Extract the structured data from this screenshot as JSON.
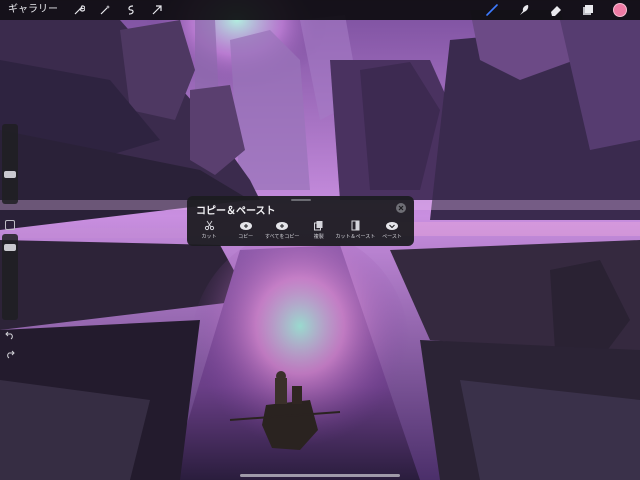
{
  "toolbar": {
    "gallery_label": "ギャラリー",
    "left_icons": [
      "wrench-icon",
      "magic-wand-icon",
      "selection-icon",
      "transform-arrow-icon"
    ],
    "right_icons": [
      "brush-icon",
      "smudge-icon",
      "eraser-icon",
      "layers-icon"
    ],
    "active_color": "#ef7ba5",
    "brush_accent": "#3d7bff"
  },
  "sidebar": {
    "size_level": 0.35,
    "opacity_level": 0.9
  },
  "copy_panel": {
    "title": "コピー＆ペースト",
    "actions": [
      {
        "id": "cut",
        "label": "カット",
        "icon": "scissors-icon"
      },
      {
        "id": "copy",
        "label": "コピー",
        "icon": "copy-icon"
      },
      {
        "id": "copy-all",
        "label": "すべてをコピー",
        "icon": "copy-all-icon"
      },
      {
        "id": "duplicate",
        "label": "複製",
        "icon": "duplicate-icon"
      },
      {
        "id": "cut-paste",
        "label": "カット＆ペースト",
        "icon": "cut-paste-icon"
      },
      {
        "id": "paste",
        "label": "ペースト",
        "icon": "paste-icon"
      }
    ]
  },
  "colors": {
    "toolbar_bg": "#0c0c0e",
    "panel_bg": "#1c1c20",
    "sky_glow": "#c26fd8",
    "water_glow": "#7fe0c8"
  }
}
